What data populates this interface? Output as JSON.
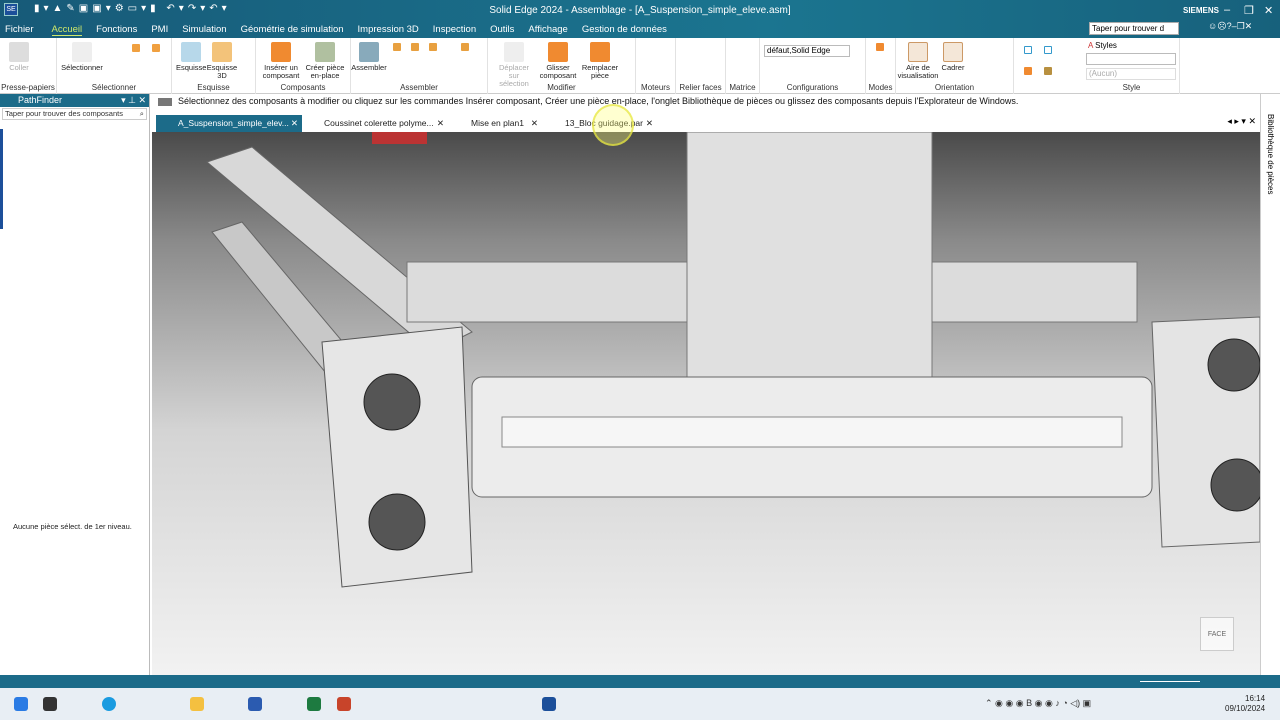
{
  "app": {
    "title": "Solid Edge 2024 - Assemblage - [A_Suspension_simple_eleve.asm]",
    "logo": "SE",
    "brand": "SIEMENS",
    "search_placeholder": "Taper pour trouver d"
  },
  "menu": [
    "Fichier",
    "Accueil",
    "Fonctions",
    "PMI",
    "Simulation",
    "Géométrie de simulation",
    "Impression 3D",
    "Inspection",
    "Outils",
    "Affichage",
    "Gestion de données"
  ],
  "ribbon": {
    "groups": [
      "Presse-papiers",
      "Sélectionner",
      "Esquisse",
      "Composants",
      "Assembler",
      "Modifier",
      "Moteurs",
      "Relier faces",
      "Matrice",
      "Configurations",
      "Modes",
      "Orientation",
      "Style"
    ],
    "buttons": {
      "coller": "Coller",
      "selectionner": "Sélectionner",
      "esquisse": "Esquisse",
      "esquisse3d": "Esquisse 3D",
      "inserer": "Insérer un composant",
      "creer": "Créer pièce en-place",
      "assembler": "Assembler",
      "deplacer": "Déplacer sur sélection",
      "glisser": "Glisser composant",
      "remplacer": "Remplacer pièce",
      "aire": "Aire de visualisation",
      "cadrer": "Cadrer",
      "styles": "Styles"
    },
    "config_value": "défaut,Solid Edge",
    "style_value": "",
    "style_aucun": "(Aucun)"
  },
  "prompt": "Sélectionnez des composants à modifier ou cliquez sur les commandes Insérer composant, Créer une pièce en-place, l'onglet Bibliothèque de pièces ou glissez des composants depuis l'Explorateur de Windows.",
  "pathfinder": {
    "title": "PathFinder",
    "search_placeholder": "Taper pour trouver des composants",
    "message": "Aucune pièce sélect. de 1er niveau."
  },
  "tabs": [
    {
      "label": "A_Suspension_simple_elev...",
      "active": true
    },
    {
      "label": "Coussinet colerette polyme..."
    },
    {
      "label": "Mise en plan1"
    },
    {
      "label": "13_Bloc guidage.par"
    }
  ],
  "right_panel": "Bibliothèque de pièces",
  "viewport": {
    "view_cube": "FACE"
  },
  "taskbar": {
    "time": "16:14",
    "date": "09/10/2024"
  },
  "colors": {
    "titlebar": "#1b7590",
    "accent": "#cfe86a"
  }
}
